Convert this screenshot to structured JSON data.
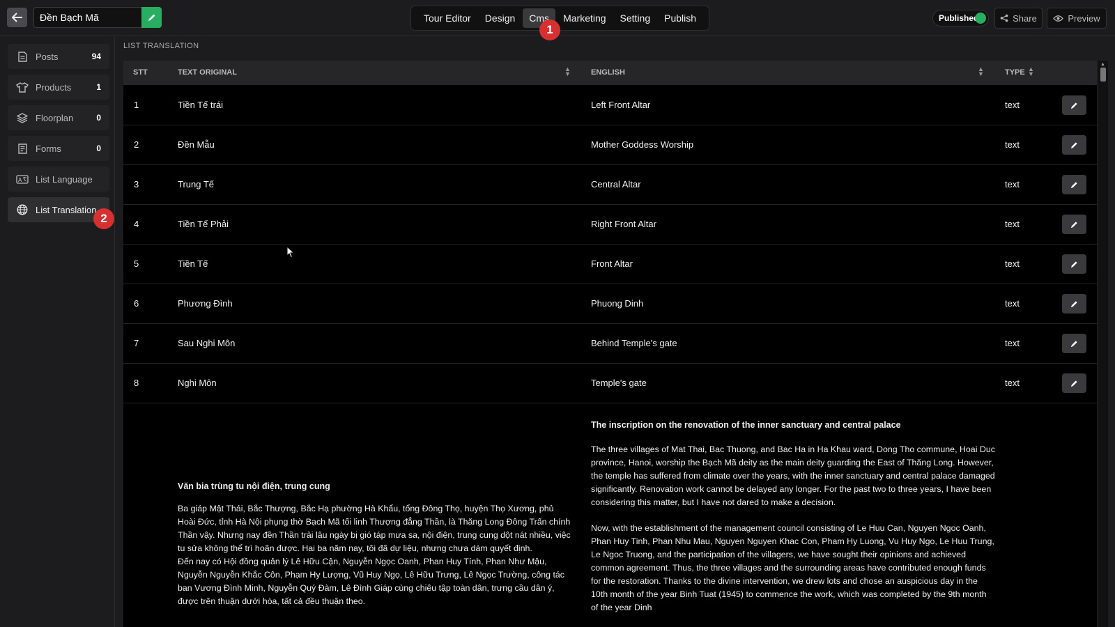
{
  "header": {
    "title_value": "Đền Bạch Mã",
    "tabs": [
      "Tour Editor",
      "Design",
      "Cms",
      "Marketing",
      "Setting",
      "Publish"
    ],
    "active_tab": "Cms",
    "published_label": "Published",
    "share_label": "Share",
    "preview_label": "Preview",
    "badge_1": "1"
  },
  "sidebar": {
    "items": [
      {
        "label": "Posts",
        "count": "94",
        "icon": "document-icon"
      },
      {
        "label": "Products",
        "count": "1",
        "icon": "shirt-icon"
      },
      {
        "label": "Floorplan",
        "count": "0",
        "icon": "layers-icon"
      },
      {
        "label": "Forms",
        "count": "0",
        "icon": "form-icon"
      },
      {
        "label": "List Language",
        "count": "",
        "icon": "language-icon"
      },
      {
        "label": "List Translation",
        "count": "",
        "icon": "globe-icon"
      }
    ],
    "badge_2": "2"
  },
  "main": {
    "section_title": "LIST TRANSLATION",
    "columns": [
      "STT",
      "TEXT ORIGINAL",
      "ENGLISH",
      "TYPE"
    ],
    "rows": [
      {
        "stt": "1",
        "original": "Tiền Tế trái",
        "english": "Left Front Altar",
        "type": "text"
      },
      {
        "stt": "2",
        "original": "Đền Mẫu",
        "english": "Mother Goddess Worship",
        "type": "text"
      },
      {
        "stt": "3",
        "original": "Trung Tế",
        "english": "Central Altar",
        "type": "text"
      },
      {
        "stt": "4",
        "original": "Tiền Tế Phải",
        "english": "Right Front Altar",
        "type": "text"
      },
      {
        "stt": "5",
        "original": "Tiền Tế",
        "english": "Front Altar",
        "type": "text"
      },
      {
        "stt": "6",
        "original": "Phương Đình",
        "english": "Phuong Dinh",
        "type": "text"
      },
      {
        "stt": "7",
        "original": "Sau Nghi Môn",
        "english": "Behind Temple's gate",
        "type": "text"
      },
      {
        "stt": "8",
        "original": "Nghi Môn",
        "english": "Temple's gate",
        "type": "text"
      }
    ],
    "long_row": {
      "original_heading": "Văn bia trùng tu nội điện, trung cung",
      "original_text": "Ba giáp Mật Thái, Bắc Thượng, Bắc Hạ phường Hà Khẩu, tổng Đông Thọ, huyện Thọ Xương, phủ Hoài Đức, tỉnh Hà Nội phụng thờ Bạch Mã tối linh Thượng đẳng Thần, là Thăng Long Đông Trấn chính Thần vậy. Nhưng nay đền Thần trải lâu ngày bị gió táp mưa sa, nội điện, trung cung dột nát nhiều, việc tu sửa không thể trì hoãn được. Hai ba năm nay, tôi đã dự liệu, nhưng chưa dám quyết định.",
      "original_text_2": "Đến nay có Hội đồng quản lý Lê Hữu Cận, Nguyễn Ngọc Oanh, Phan Huy Tính, Phan Như Mậu, Nguyễn Nguyễn Khắc Côn, Phạm Hy Lượng, Vũ Huy Ngọ, Lê Hữu Trưng, Lê Ngọc Trường, công tác ban Vương Đình Minh, Nguyễn Quý Đàm, Lê Đình Giáp cùng chiêu tập toàn dân, trưng cầu dân ý, được trên thuận dưới hòa, tất cả đều thuận theo.",
      "english_heading": "The inscription on the renovation of the inner sanctuary and central palace",
      "english_p1": "The three villages of Mat Thai, Bac Thuong, and Bac Ha in Ha Khau ward, Dong Tho commune, Hoai Duc province, Hanoi, worship the Bạch Mã deity as the main deity guarding the East of Thăng Long. However, the temple has suffered from climate over the years, with the inner sanctuary and central palace damaged significantly. Renovation work cannot be delayed any longer. For the past two to three years, I have been considering this matter, but I have not dared to make a decision.",
      "english_p2": "Now, with the establishment of the management council consisting of Le Huu Can, Nguyen Ngoc Oanh, Phan Huy Tinh, Phan Nhu Mau, Nguyen Nguyen Khac Con, Pham Hy Luong, Vu Huy Ngo, Le Huu Trung, Le Ngoc Truong, and the participation of the villagers, we have sought their opinions and achieved common agreement. Thus, the three villages and the surrounding areas have contributed enough funds for the restoration. Thanks to the divine intervention, we drew lots and chose an auspicious day in the 10th month of the year Binh Tuat (1945) to commence the work, which was completed by the 9th month of the year Dinh"
    }
  },
  "colors": {
    "accent_green": "#27ae60",
    "badge_red": "#d63031",
    "background": "#1c1c1e",
    "table_bg": "#000000"
  }
}
